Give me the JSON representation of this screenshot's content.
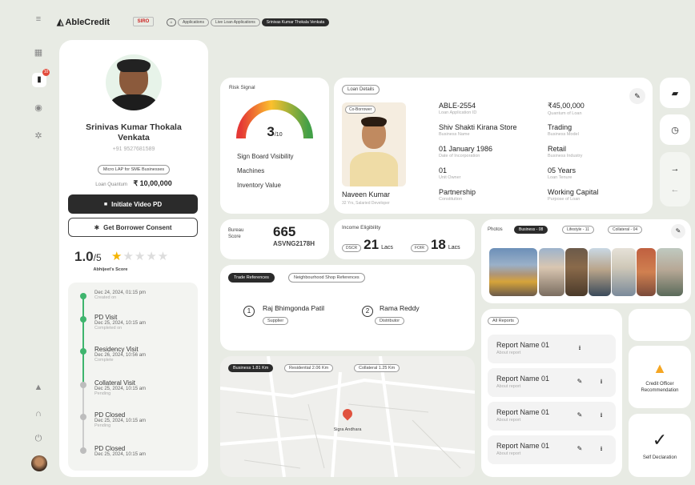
{
  "header": {
    "brand": "AbleCredit",
    "partner_logo": "SIRO",
    "breadcrumb": [
      "Applications",
      "Live Loan Applications",
      "Srinivas Kumar Thokala Venkata"
    ]
  },
  "sidebar": {
    "icons": [
      "menu-icon",
      "dashboard-icon",
      "document-icon",
      "user-icon",
      "settings-icon",
      "bell-icon",
      "headset-icon",
      "power-icon",
      "avatar"
    ],
    "badge": "10"
  },
  "profile": {
    "name": "Srinivas Kumar Thokala Venkata",
    "phone": "+91 9527681589",
    "segment": "Micro LAP for SME Businesses",
    "loan_quantum_label": "Loan Quantum",
    "loan_quantum_value": "₹ 10,00,000",
    "video_pd_button": "Initiate Video PD",
    "consent_button": "Get Borrower Consent",
    "score": "1.0",
    "score_max": "/5",
    "score_label": "Abhijeet's Score",
    "rating_stars": 1
  },
  "timeline": [
    {
      "date": "Dec 24, 2024, 01:15 pm",
      "status": "Created on",
      "title": "",
      "state": "done"
    },
    {
      "title": "PD Visit",
      "date": "Dec 25, 2024, 10:15 am",
      "status": "Completed on",
      "state": "done"
    },
    {
      "title": "Residency Visit",
      "date": "Dec 26, 2024, 10:56 am",
      "status": "Complete",
      "state": "done"
    },
    {
      "title": "Collateral Visit",
      "date": "Dec 25, 2024, 10:15 am",
      "status": "Pending",
      "state": "pending"
    },
    {
      "title": "PD Closed",
      "date": "Dec 25, 2024, 10:15 am",
      "status": "Pending",
      "state": "pending"
    },
    {
      "title": "PD Closed",
      "date": "Dec 25, 2024, 10:15 am",
      "status": "",
      "state": "pending"
    }
  ],
  "risk": {
    "title": "Risk Signal",
    "score": "3",
    "score_max": "/10",
    "score_fraction": 0.3,
    "items": [
      "Sign Board Visibility",
      "Machines",
      "Inventory Value"
    ]
  },
  "loan_details": {
    "title": "Loan Details",
    "co_borrower_label": "Co-Borrower",
    "co_borrower_name": "Naveen Kumar",
    "co_borrower_sub": "32 Yrs, Salaried Developer",
    "fields_left": [
      {
        "value": "ABLE-2554",
        "key": "Loan Application ID"
      },
      {
        "value": "Shiv Shakti Kirana Store",
        "key": "Business Name"
      },
      {
        "value": "01 January 1986",
        "key": "Date of Incorporation"
      },
      {
        "value": "01",
        "key": "Unit Owner"
      },
      {
        "value": "Partnership",
        "key": "Constitution"
      }
    ],
    "fields_right": [
      {
        "value": "₹45,00,000",
        "key": "Quantum of Loan"
      },
      {
        "value": "Trading",
        "key": "Business Model"
      },
      {
        "value": "Retail",
        "key": "Business Industry"
      },
      {
        "value": "05 Years",
        "key": "Loan Tenure"
      },
      {
        "value": "Working Capital",
        "key": "Purpose of Loan"
      }
    ]
  },
  "bureau": {
    "label": "Bureau Score",
    "score": "665",
    "id": "ASVNG2178H"
  },
  "income": {
    "title": "Income Eligibility",
    "dscr_tag": "DSCR",
    "dscr_value": "21",
    "dscr_unit": "Lacs",
    "foir_tag": "FOIR",
    "foir_value": "18",
    "foir_unit": "Lacs"
  },
  "photos": {
    "title": "Photos",
    "tabs": [
      "Business - 08",
      "Lifestyle - 11",
      "Collateral - 04"
    ]
  },
  "references": {
    "tabs": [
      "Trade References",
      "Neighbourhood Shop References"
    ],
    "items": [
      {
        "num": "1",
        "name": "Raj Bhimgonda Patil",
        "role": "Supplier"
      },
      {
        "num": "2",
        "name": "Rama Reddy",
        "role": "Distributor"
      }
    ]
  },
  "map": {
    "tabs": [
      "Business 1.81 Km",
      "Residential 2.06 Km",
      "Collateral 1.25 Km"
    ],
    "pin_label": "Sigra Andhara"
  },
  "reports": {
    "title": "All Reports",
    "items": [
      {
        "name": "Report Name 01",
        "sub": "About report"
      },
      {
        "name": "Report Name 01",
        "sub": "About report"
      },
      {
        "name": "Report Name 01",
        "sub": "About report"
      },
      {
        "name": "Report Name 01",
        "sub": "About report"
      }
    ]
  },
  "actions": {
    "recommendation": "Credit Officer Recommendation",
    "self_declaration": "Self Declaration"
  },
  "colors": {
    "accent_green": "#3fb56e",
    "dark": "#2b2b2b",
    "badge_red": "#e24b3b",
    "star": "#f5b400",
    "pin": "#e0523e"
  }
}
